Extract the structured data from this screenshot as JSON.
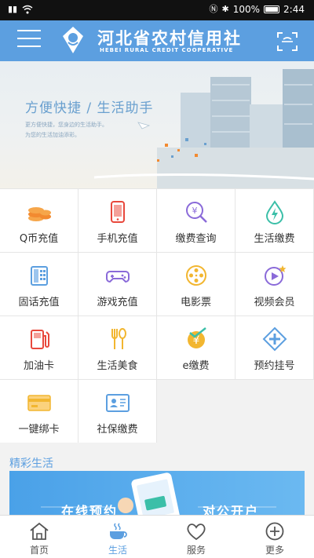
{
  "status_bar": {
    "battery": "100%",
    "time": "2:44"
  },
  "header": {
    "title": "河北省农村信用社",
    "subtitle": "HEBEI RURAL CREDIT COOPERATIVE"
  },
  "banner": {
    "headline": "方便快捷 / 生活助手",
    "line1": "更方便快捷，您身边的生活助手。",
    "line2": "为您的生活加油添彩。"
  },
  "services": [
    {
      "label": "Q币充值",
      "icon": "coins-icon"
    },
    {
      "label": "手机充值",
      "icon": "phone-icon"
    },
    {
      "label": "缴费查询",
      "icon": "bill-search-icon"
    },
    {
      "label": "生活缴费",
      "icon": "water-drop-icon"
    },
    {
      "label": "固话充值",
      "icon": "landline-icon"
    },
    {
      "label": "游戏充值",
      "icon": "gamepad-icon"
    },
    {
      "label": "电影票",
      "icon": "film-reel-icon"
    },
    {
      "label": "视频会员",
      "icon": "video-play-icon"
    },
    {
      "label": "加油卡",
      "icon": "fuel-pump-icon"
    },
    {
      "label": "生活美食",
      "icon": "fork-spoon-icon"
    },
    {
      "label": "e缴费",
      "icon": "yuan-check-icon"
    },
    {
      "label": "预约挂号",
      "icon": "medical-cross-icon"
    },
    {
      "label": "一键绑卡",
      "icon": "bank-card-icon"
    },
    {
      "label": "社保缴费",
      "icon": "id-card-icon"
    }
  ],
  "section": {
    "title": "精彩生活"
  },
  "promo": {
    "left": "在线预约",
    "right": "对公开户"
  },
  "tabs": [
    {
      "label": "首页",
      "icon": "home-icon"
    },
    {
      "label": "生活",
      "icon": "coffee-cup-icon"
    },
    {
      "label": "服务",
      "icon": "heart-icon"
    },
    {
      "label": "更多",
      "icon": "plus-circle-icon"
    }
  ],
  "colors": {
    "primary": "#5c9fe0",
    "accent_orange": "#f28a30",
    "accent_purple": "#8a6ad9",
    "accent_teal": "#3bbfa8"
  }
}
